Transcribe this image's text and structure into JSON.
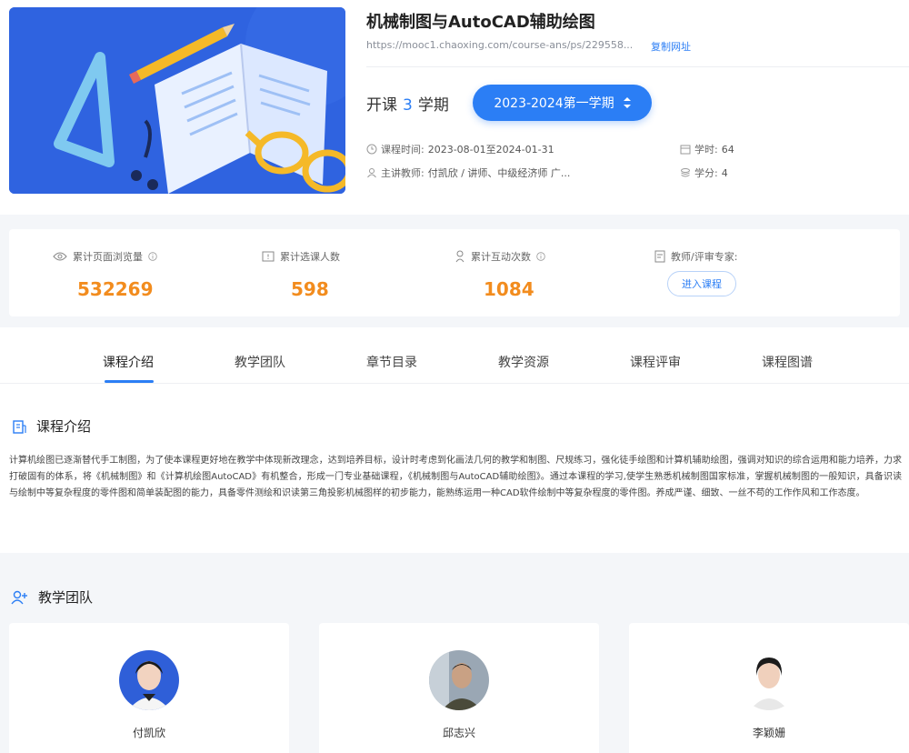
{
  "course": {
    "title": "机械制图与AutoCAD辅助绘图",
    "url": "https://mooc1.chaoxing.com/course-ans/ps/229558...",
    "copy_link": "复制网址",
    "open_prefix": "开课",
    "open_count": "3",
    "open_suffix": "学期",
    "term": "2023-2024第一学期",
    "time_label": "课程时间:",
    "time_value": "2023-08-01至2024-01-31",
    "teacher_label": "主讲教师:",
    "teacher_value": "付凯欣 / 讲师、中级经济师 广...",
    "hours_label": "学时:",
    "hours_value": "64",
    "credit_label": "学分:",
    "credit_value": "4"
  },
  "stats": {
    "views_label": "累计页面浏览量",
    "views_value": "532269",
    "enroll_label": "累计选课人数",
    "enroll_value": "598",
    "interact_label": "累计互动次数",
    "interact_value": "1084",
    "expert_label": "教师/评审专家:",
    "enter_label": "进入课程"
  },
  "tabs": [
    "课程介绍",
    "教学团队",
    "章节目录",
    "教学资源",
    "课程评审",
    "课程图谱"
  ],
  "intro": {
    "heading": "课程介绍",
    "text": "计算机绘图已逐渐替代手工制图，为了使本课程更好地在教学中体现新改理念，达到培养目标，设计时考虑到化画法几何的教学和制图、尺规练习，强化徒手绘图和计算机辅助绘图，强调对知识的综合运用和能力培养，力求打破固有的体系，将《机械制图》和《计算机绘图AutoCAD》有机整合，形成一门专业基础课程，《机械制图与AutoCAD辅助绘图》。通过本课程的学习,使学生熟悉机械制图国家标准，掌握机械制图的一般知识，具备识读与绘制中等复杂程度的零件图和简单装配图的能力，具备零件测绘和识读第三角投影机械图样的初步能力，能熟练运用一种CAD软件绘制中等复杂程度的零件图。养成严谨、细致、一丝不苟的工作作风和工作态度。"
  },
  "team": {
    "heading": "教学团队",
    "members": [
      {
        "name": "付凯欣"
      },
      {
        "name": "邱志兴"
      },
      {
        "name": "李颖姗"
      }
    ]
  },
  "colors": {
    "accent": "#2b7ef5",
    "stat_value": "#f28c1e"
  }
}
